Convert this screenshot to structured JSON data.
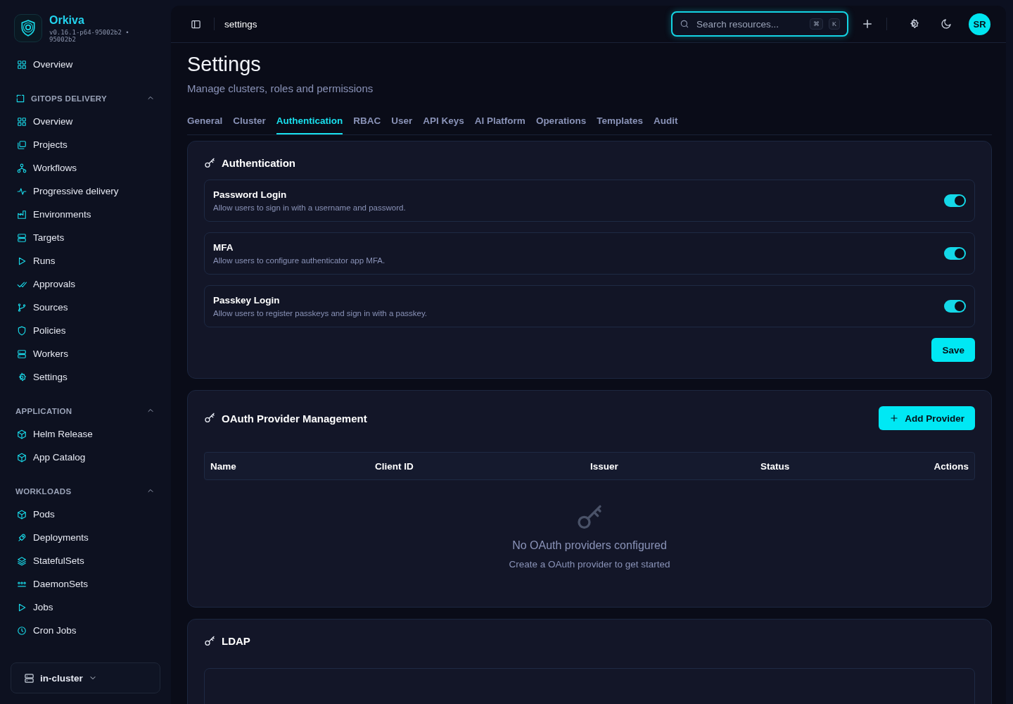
{
  "brand": {
    "name": "Orkiva",
    "version": "v0.16.1-p64-95002b2 • 95002b2"
  },
  "sidebar": {
    "top_items": [
      {
        "label": "Overview",
        "selected": false
      }
    ],
    "sections": [
      {
        "title": "GITOPS DELIVERY",
        "expanded": true,
        "items": [
          {
            "label": "Overview",
            "selected": false
          },
          {
            "label": "Projects",
            "selected": false
          },
          {
            "label": "Workflows",
            "selected": false
          },
          {
            "label": "Progressive delivery",
            "selected": false
          },
          {
            "label": "Environments",
            "selected": false
          },
          {
            "label": "Targets",
            "selected": false
          },
          {
            "label": "Runs",
            "selected": false
          },
          {
            "label": "Approvals",
            "selected": false
          },
          {
            "label": "Sources",
            "selected": false
          },
          {
            "label": "Policies",
            "selected": false
          },
          {
            "label": "Workers",
            "selected": false
          },
          {
            "label": "Settings",
            "selected": false
          }
        ]
      },
      {
        "title": "APPLICATION",
        "expanded": true,
        "items": [
          {
            "label": "Helm Release",
            "selected": false
          },
          {
            "label": "App Catalog",
            "selected": false
          }
        ]
      },
      {
        "title": "WORKLOADS",
        "expanded": true,
        "items": [
          {
            "label": "Pods",
            "selected": false
          },
          {
            "label": "Deployments",
            "selected": false
          },
          {
            "label": "StatefulSets",
            "selected": false
          },
          {
            "label": "DaemonSets",
            "selected": false
          },
          {
            "label": "Jobs",
            "selected": false
          },
          {
            "label": "Cron Jobs",
            "selected": false
          }
        ]
      }
    ],
    "cluster": "in-cluster"
  },
  "header": {
    "breadcrumb": "settings",
    "search": {
      "placeholder": "Search resources...",
      "keys": [
        "⌘",
        "K"
      ]
    },
    "avatar": "SR"
  },
  "page": {
    "title": "Settings",
    "subtitle": "Manage clusters, roles and permissions"
  },
  "tabs": [
    {
      "label": "General",
      "selected": false
    },
    {
      "label": "Cluster",
      "selected": false
    },
    {
      "label": "Authentication",
      "selected": true
    },
    {
      "label": "RBAC",
      "selected": false
    },
    {
      "label": "User",
      "selected": false
    },
    {
      "label": "API Keys",
      "selected": false
    },
    {
      "label": "AI Platform",
      "selected": false
    },
    {
      "label": "Operations",
      "selected": false
    },
    {
      "label": "Templates",
      "selected": false
    },
    {
      "label": "Audit",
      "selected": false
    }
  ],
  "authentication": {
    "title": "Authentication",
    "options": [
      {
        "name": "Password Login",
        "description": "Allow users to sign in with a username and password.",
        "on": true
      },
      {
        "name": "MFA",
        "description": "Allow users to configure authenticator app MFA.",
        "on": true
      },
      {
        "name": "Passkey Login",
        "description": "Allow users to register passkeys and sign in with a passkey.",
        "on": true
      }
    ],
    "save_button": "Save"
  },
  "oauth": {
    "title": "OAuth Provider Management",
    "add_button": "Add Provider",
    "table": {
      "columns": [
        "Name",
        "Client ID",
        "Issuer",
        "Status",
        "Actions"
      ]
    },
    "empty": {
      "title": "No OAuth providers configured",
      "hint": "Create a OAuth provider to get started"
    }
  },
  "ldap": {
    "title": "LDAP"
  }
}
